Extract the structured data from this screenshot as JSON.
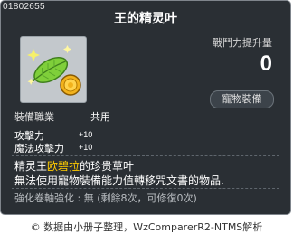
{
  "item": {
    "id": "01802655",
    "name": "王的精灵叶"
  },
  "power": {
    "label": "戰鬥力提升量",
    "value": "0"
  },
  "badge": "寵物裝備",
  "job": {
    "label": "裝備職業",
    "value": "共用"
  },
  "stats": [
    {
      "name": "攻擊力",
      "value": "+10"
    },
    {
      "name": "魔法攻擊力",
      "value": "+10"
    }
  ],
  "description": {
    "line1_a": "精灵王",
    "line1_highlight": "欧碧拉",
    "line1_b": "的珍贵草叶",
    "line2": "無法使用寵物裝備能力值轉移咒文書的物品."
  },
  "scroll": {
    "label": "強化卷軸強化 : 無",
    "detail": "(剩餘8次，可修復0次)"
  },
  "footer": "数据由小册子整理，WzComparerR2-NTMS解析",
  "colors": {
    "background": "#2a2f34",
    "highlight": "#ffcc00",
    "icon_bg": "#c3c8cc"
  },
  "icons": [
    "green-leaf-icon",
    "gold-coin-icon",
    "copyright-icon"
  ]
}
